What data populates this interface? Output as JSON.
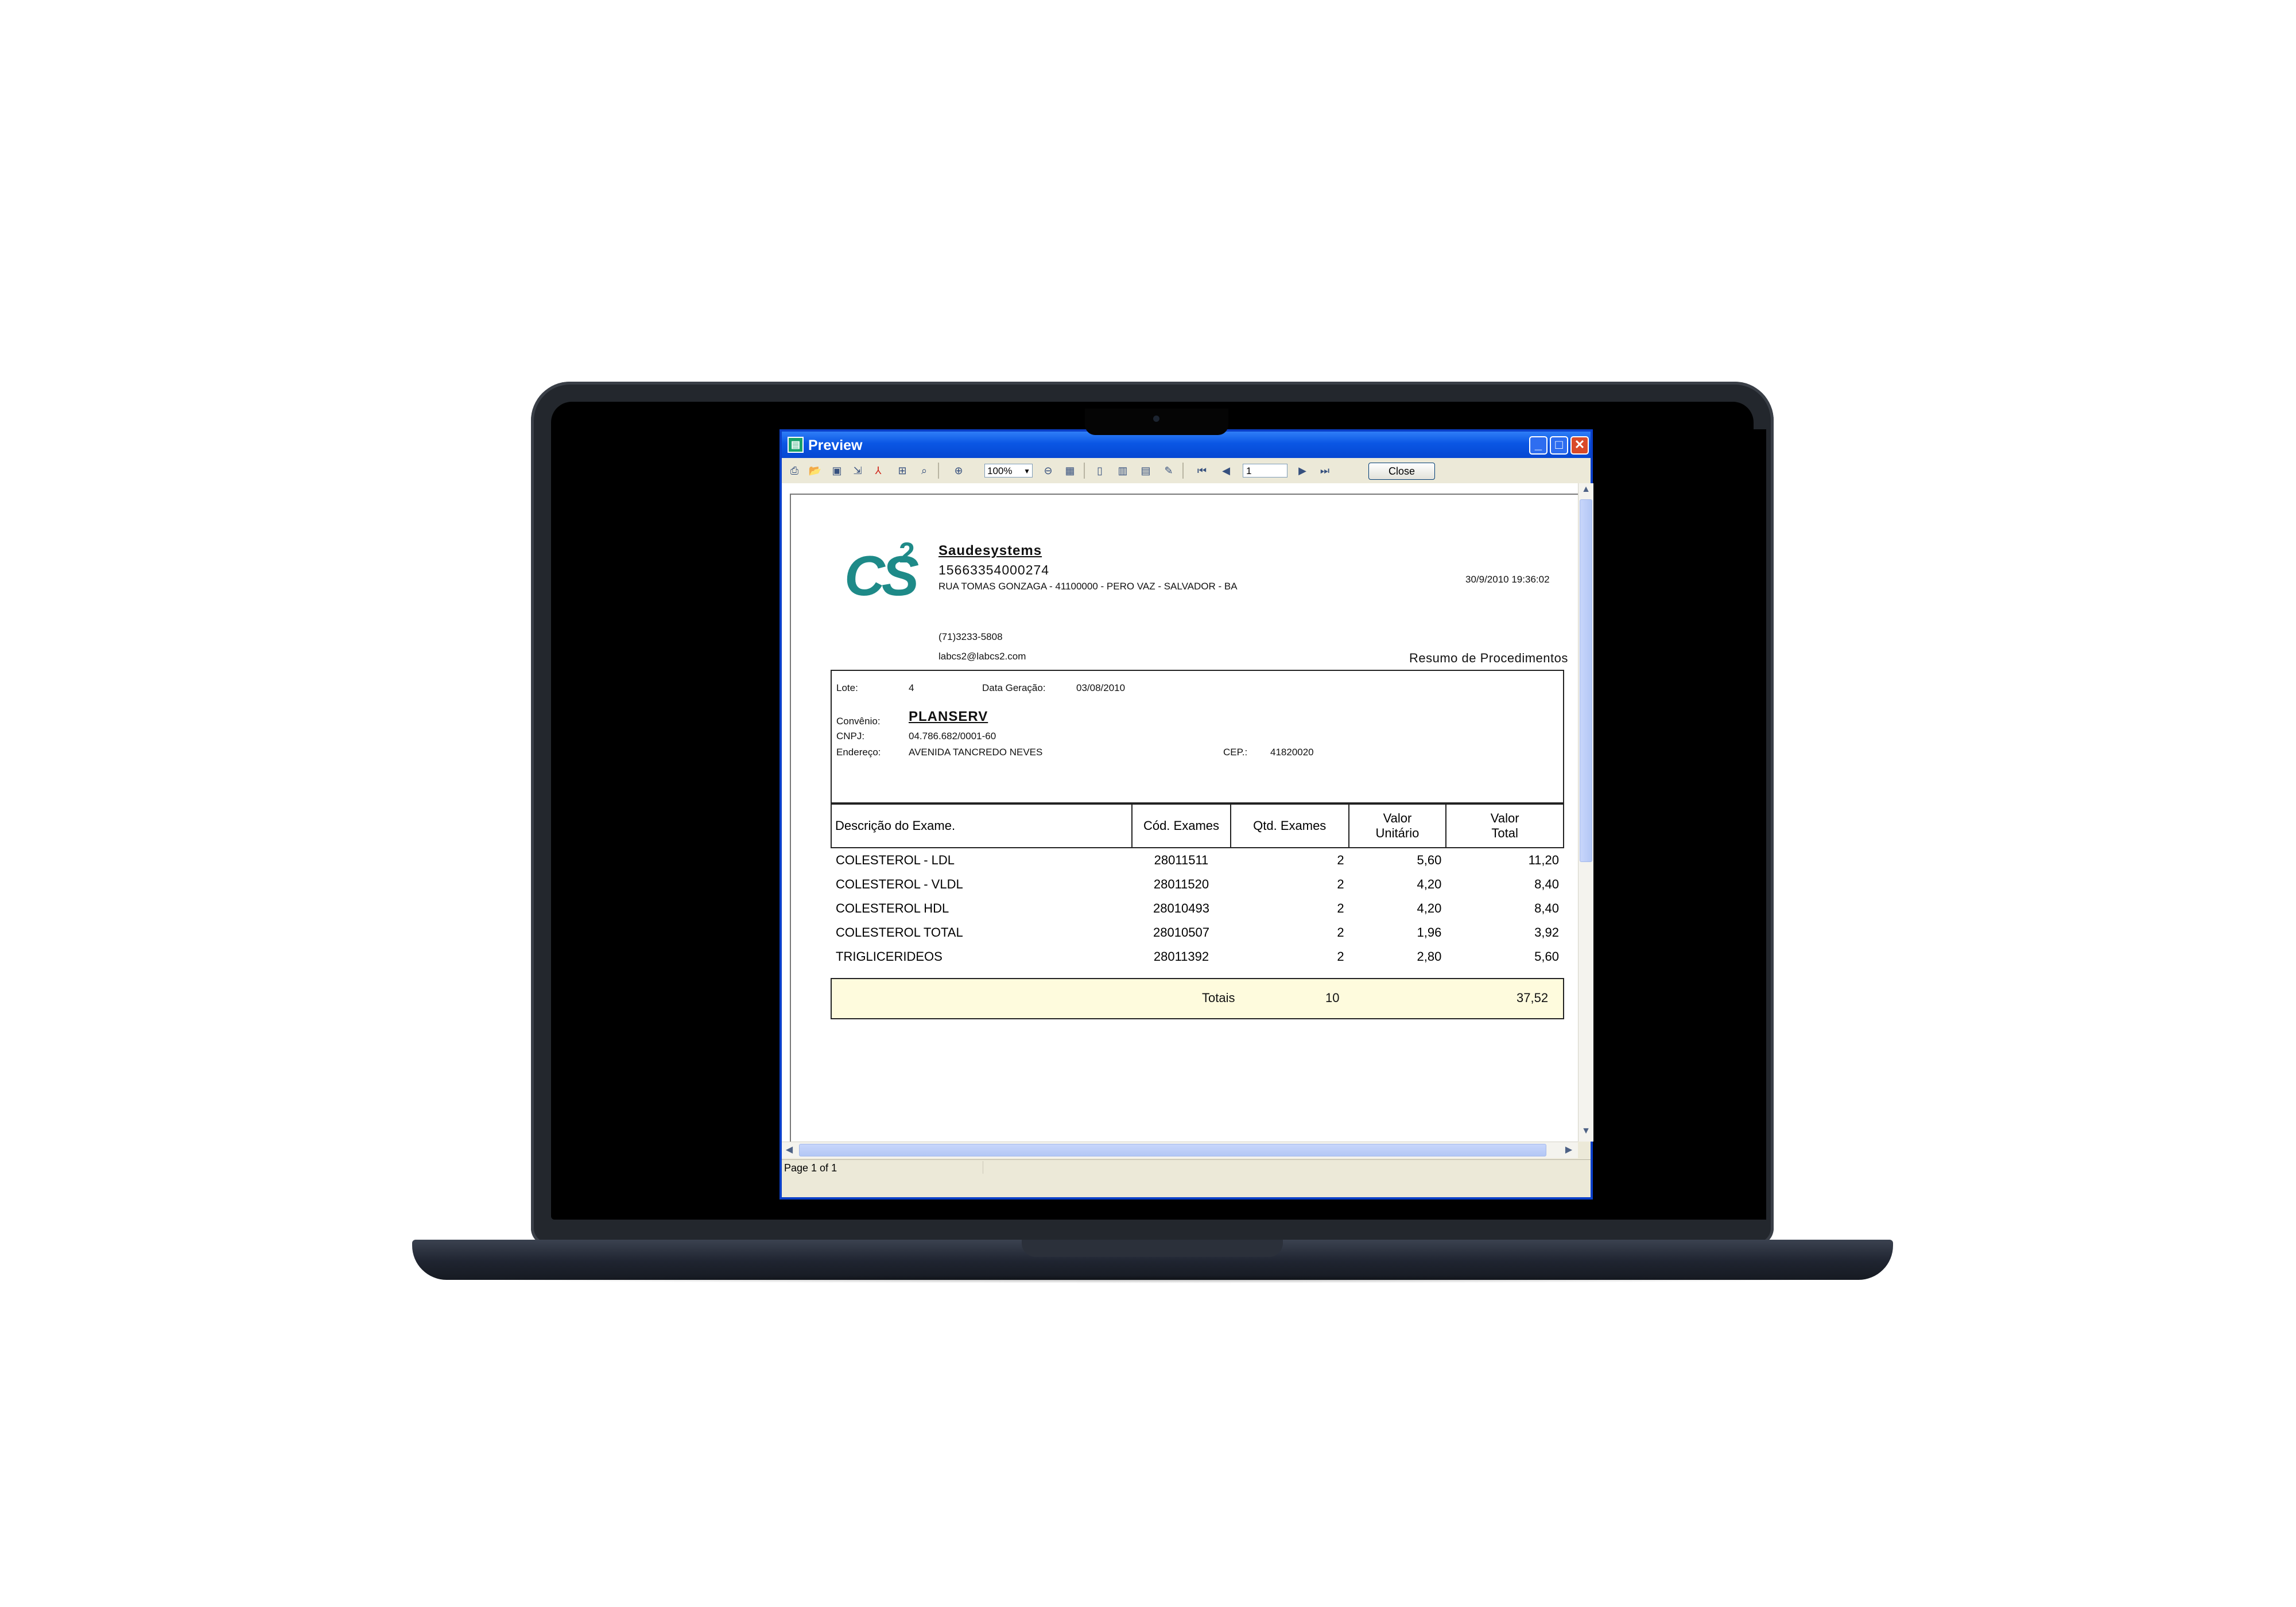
{
  "window": {
    "title": "Preview",
    "status_text": "Page 1 of 1"
  },
  "toolbar": {
    "zoom_value": "100%",
    "page_number": "1",
    "close_label": "Close",
    "icons": [
      "print-icon",
      "open-icon",
      "save-icon",
      "export-icon",
      "pdf-icon",
      "print-setup-icon",
      "find-icon",
      "zoom-in-icon",
      "zoom-out-icon",
      "fit-page-icon",
      "single-page-icon",
      "two-pages-icon",
      "multi-page-icon",
      "edit-icon",
      "first-page-icon",
      "prev-page-icon",
      "next-page-icon",
      "last-page-icon"
    ]
  },
  "report": {
    "logo_text": "CS",
    "logo_superscript": "2",
    "logo_color": "#1e8a88",
    "company_name": "Saudesystems",
    "company_cnpj": "15663354000274",
    "company_address": "RUA TOMAS GONZAGA -  41100000 - PERO VAZ - SALVADOR - BA",
    "generated_at": "30/9/2010 19:36:02",
    "phone": "(71)3233-5808",
    "email": "labcs2@labcs2.com",
    "title": "Resumo de Procedimentos",
    "info": {
      "lote_label": "Lote:",
      "lote_value": "4",
      "data_geracao_label": "Data Geração:",
      "data_geracao_value": "03/08/2010",
      "convenio_label": "Convênio:",
      "convenio_value": "PLANSERV",
      "cnpj_label": "CNPJ:",
      "cnpj_value": "04.786.682/0001-60",
      "endereco_label": "Endereço:",
      "endereco_value": "AVENIDA TANCREDO NEVES",
      "cep_label": "CEP.:",
      "cep_value": "41820020"
    },
    "table": {
      "headers": {
        "descricao": "Descrição do Exame.",
        "codigo": "Cód. Exames",
        "qtd": "Qtd. Exames",
        "valor_unitario_1": "Valor",
        "valor_unitario_2": "Unitário",
        "valor_total_1": "Valor",
        "valor_total_2": "Total"
      },
      "rows": [
        {
          "descricao": "COLESTEROL - LDL",
          "codigo": "28011511",
          "qtd": "2",
          "unitario": "5,60",
          "total": "11,20"
        },
        {
          "descricao": "COLESTEROL - VLDL",
          "codigo": "28011520",
          "qtd": "2",
          "unitario": "4,20",
          "total": "8,40"
        },
        {
          "descricao": "COLESTEROL HDL",
          "codigo": "28010493",
          "qtd": "2",
          "unitario": "4,20",
          "total": "8,40"
        },
        {
          "descricao": "COLESTEROL TOTAL",
          "codigo": "28010507",
          "qtd": "2",
          "unitario": "1,96",
          "total": "3,92"
        },
        {
          "descricao": "TRIGLICERIDEOS",
          "codigo": "28011392",
          "qtd": "2",
          "unitario": "2,80",
          "total": "5,60"
        }
      ],
      "totals_label": "Totais",
      "totals_qtd": "10",
      "totals_valor": "37,52"
    }
  }
}
